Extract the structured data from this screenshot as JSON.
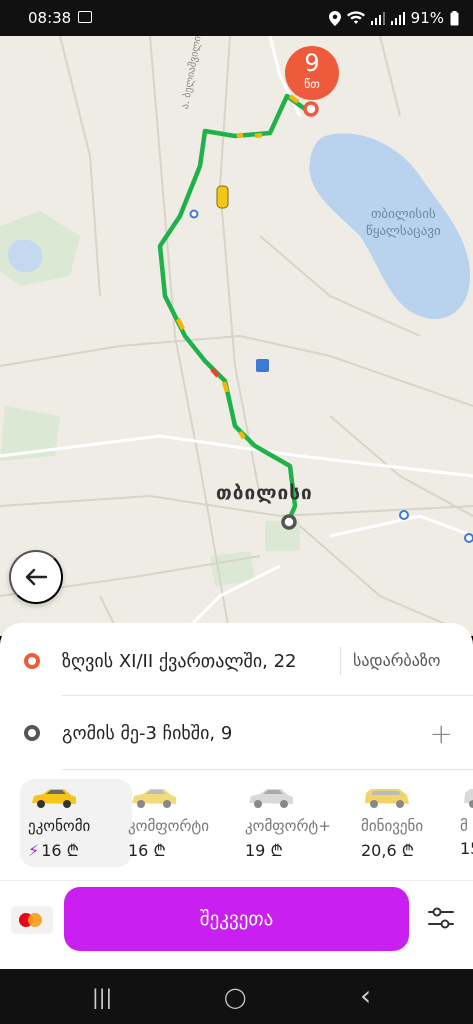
{
  "status_bar": {
    "time": "08:38",
    "battery": "91%",
    "icons": [
      "image-icon",
      "location-icon",
      "wifi-icon",
      "signal-icon",
      "signal-icon",
      "battery-icon"
    ]
  },
  "map": {
    "eta_value": "9",
    "eta_unit": "წთ",
    "city_label": "თბილისი",
    "lake_label_line1": "თბილისის",
    "lake_label_line2": "წყალსაცავი",
    "street_label": "ა. ბელიაშვილის ქუჩა",
    "colors": {
      "route_green": "#1fb24a",
      "route_yellow": "#f2b705",
      "route_red": "#e5452b",
      "pickup": "#f05a3c",
      "water": "#b9d3ef"
    }
  },
  "back_button_icon": "arrow-left-icon",
  "addresses": {
    "from": "ზღვის XI/II ქვართალში, 22",
    "from_home_link": "სადარბაზო",
    "to": "გომის მე-3 ჩიხში, 9",
    "add_stop_icon": "plus-icon"
  },
  "tariffs": [
    {
      "name": "ეკონომი",
      "price": "16 ₾",
      "boost": "⚡",
      "selected": true,
      "car_color": "#f5c518"
    },
    {
      "name": "კომფორტი",
      "price": "16 ₾",
      "boost": "",
      "selected": false,
      "car_color": "#f1da7a"
    },
    {
      "name": "კომფორტ+",
      "price": "19 ₾",
      "boost": "",
      "selected": false,
      "car_color": "#d9d9d9"
    },
    {
      "name": "მინივენი",
      "price": "20,6 ₾",
      "boost": "",
      "selected": false,
      "car_color": "#f1d46a"
    },
    {
      "name": "მ",
      "price": "15",
      "boost": "",
      "selected": false,
      "car_color": "#d9d9d9"
    }
  ],
  "payment": {
    "card_icon": "mastercard-icon"
  },
  "order_button": "შეკვეთა",
  "options_icon": "sliders-icon",
  "nav": {
    "recent": "|||",
    "home": "◯",
    "back": "‹"
  }
}
